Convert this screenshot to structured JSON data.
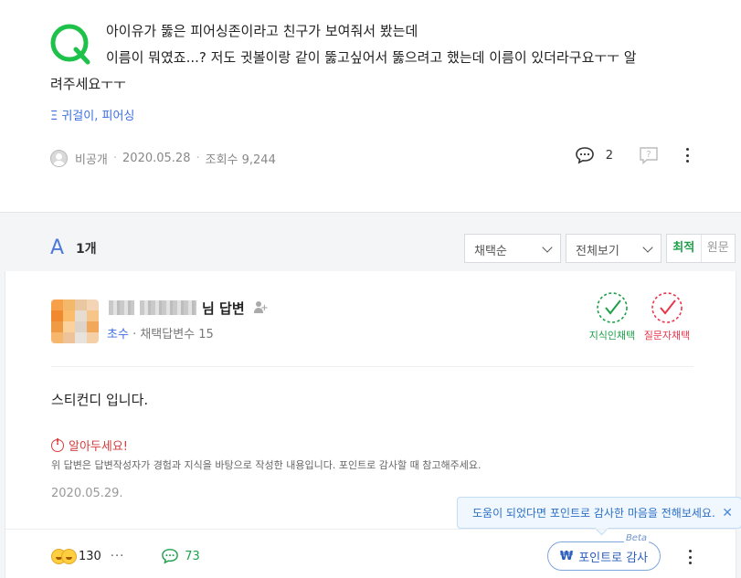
{
  "question": {
    "line1": "아이유가 뚫은 피어싱존이라고 친구가 보여줘서 봤는데",
    "line2": "이름이 뭐였죠...? 저도 귓볼이랑 같이 뚫고싶어서 뚫으려고 했는데 이름이 있더라구요ㅜㅜ 알",
    "line3": "려주세요ㅜㅜ",
    "tags": "Ξ 귀걸이, 피어싱",
    "author": "비공개",
    "date": "2020.05.28",
    "views": "조회수 9,244",
    "comment_count": "2"
  },
  "answer_header": {
    "letter": "A",
    "count": "1개",
    "sort_select": "채택순",
    "filter_select": "전체보기",
    "seg_latest": "최적",
    "seg_original": "원문"
  },
  "answer": {
    "name_suffix": "님 답변",
    "rank": "초수",
    "adopted": "채택답변수 15",
    "badge_expert": "지식인채택",
    "badge_asker": "질문자채택",
    "body": "스티컨디 입니다.",
    "notice_title": "알아두세요!",
    "notice_desc": "위 답변은 답변작성자가 경험과 지식을 바탕으로 작성한 내용입니다. 포인트로 감사할 때 참고해주세요.",
    "date": "2020.05.29.",
    "tooltip": "도움이 되었다면 포인트로 감사한 마음을 전해보세요.",
    "reaction_count": "130",
    "comment_count": "73",
    "point_button": "포인트로 감사",
    "beta": "Beta",
    "won_symbol": "₩"
  },
  "colors": {
    "green": "#1ea04a",
    "red": "#e8384f",
    "blue": "#3f6fdf"
  }
}
